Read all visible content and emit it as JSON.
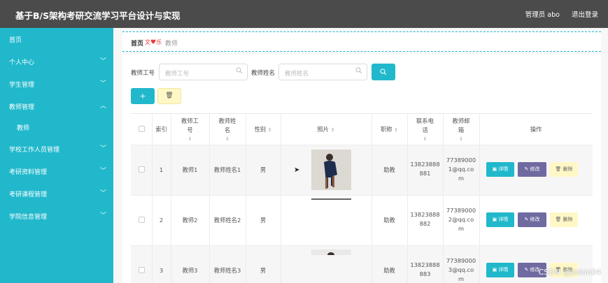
{
  "header": {
    "title": "基于B/S架构考研交流学习平台设计与实现",
    "user": "管理员 abo",
    "logout": "退出登录"
  },
  "sidebar": {
    "items": [
      {
        "label": "首页",
        "chevron": ""
      },
      {
        "label": "个人中心",
        "chevron": "﹀"
      },
      {
        "label": "学生管理",
        "chevron": "﹀"
      },
      {
        "label": "教师管理",
        "chevron": "︿"
      },
      {
        "label": "教师",
        "chevron": ""
      },
      {
        "label": "学校工作人员管理",
        "chevron": "﹀"
      },
      {
        "label": "考研资料管理",
        "chevron": "﹀"
      },
      {
        "label": "考研课程管理",
        "chevron": "﹀"
      },
      {
        "label": "学院信息管理",
        "chevron": "﹀"
      }
    ]
  },
  "breadcrumb": {
    "home": "首页",
    "heart": "♥",
    "current": "教师"
  },
  "search": {
    "label1": "教师工号",
    "placeholder1": "教师工号",
    "label2": "教师姓名",
    "placeholder2": "教师姓名"
  },
  "toolbar": {
    "add": "+",
    "delete": "🗑"
  },
  "table": {
    "headers": {
      "index": "索引",
      "gonghao": [
        "教师工",
        "号"
      ],
      "xingming": [
        "教师姓",
        "名"
      ],
      "gender": "性别",
      "photo": "照片",
      "title": "职称",
      "phone": [
        "联系电",
        "话"
      ],
      "email": [
        "教师邮",
        "箱"
      ],
      "ops": "操作"
    },
    "rows": [
      {
        "index": "1",
        "gonghao": "教师1",
        "xingming": "教师姓名1",
        "gender": "男",
        "title": "助教",
        "phone": [
          "13823888",
          "881"
        ],
        "email": [
          "77389000",
          "1@qq.co",
          "m"
        ]
      },
      {
        "index": "2",
        "gonghao": "教师2",
        "xingming": "教师姓名2",
        "gender": "男",
        "title": "助教",
        "phone": [
          "13823888",
          "882"
        ],
        "email": [
          "77389000",
          "2@qq.co",
          "m"
        ]
      },
      {
        "index": "3",
        "gonghao": "教师3",
        "xingming": "教师姓名3",
        "gender": "男",
        "title": "助教",
        "phone": [
          "13823888",
          "883"
        ],
        "email": [
          "77389000",
          "3@qq.co",
          "m"
        ]
      }
    ],
    "actions": {
      "view": "▣ 详情",
      "edit": "✎ 修改",
      "del": "🗑 删除"
    }
  },
  "watermark": "CSDN @jinkin04",
  "colors": {
    "accent": "#21b8cc",
    "header": "#4b4b4b",
    "edit": "#6f6aa0",
    "del": "#fff8c6"
  }
}
